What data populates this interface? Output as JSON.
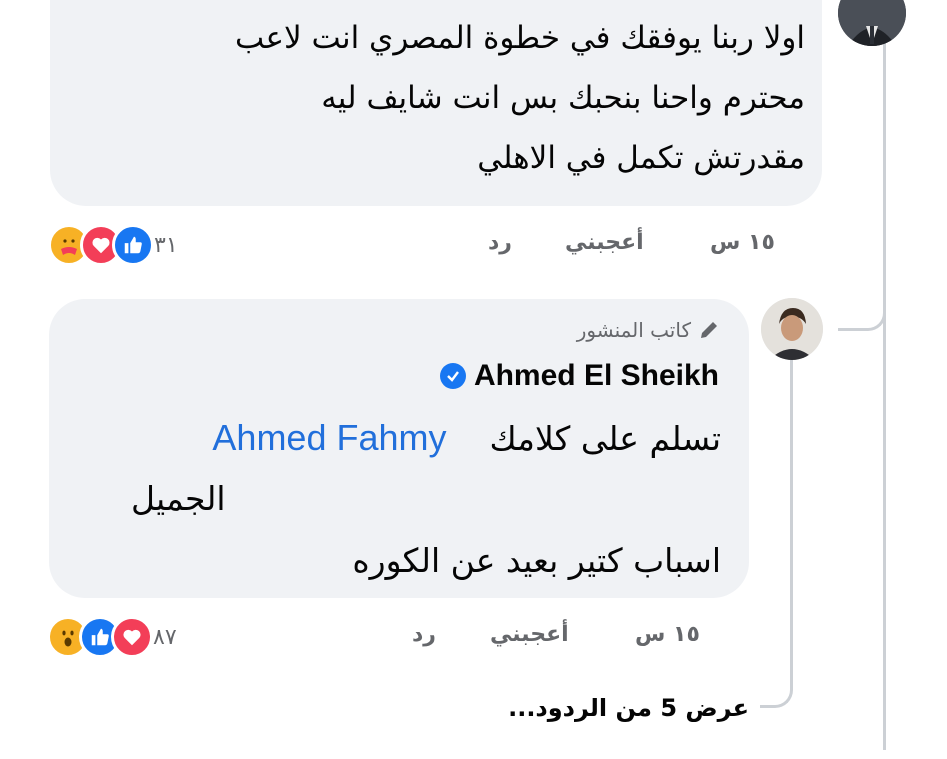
{
  "colors": {
    "bubble": "#f0f2f5",
    "thread_line": "#ccd0d5",
    "meta_text": "#65676b",
    "mention": "#216fdb",
    "like": "#1877f2",
    "love": "#f33e58",
    "care_wow": "#f7b125"
  },
  "comment1": {
    "lines": [
      "اولا ربنا يوفقك في خطوة المصري انت لاعب",
      "محترم واحنا بنحبك بس انت شايف ليه",
      "مقدرتش تكمل في الاهلي"
    ],
    "time": "١٥ س",
    "like_label": "أعجبني",
    "reply_label": "رد",
    "reaction_count": "٣١",
    "reactions": [
      "like-icon",
      "love-icon",
      "care-icon"
    ]
  },
  "comment2": {
    "author_badge_label": "كاتب المنشور",
    "author_name": "Ahmed El Sheikh",
    "mention": "Ahmed Fahmy",
    "line1": "تسلم على كلامك",
    "line2": "الجميل",
    "line3": "اسباب كتير بعيد عن الكوره",
    "time": "١٥ س",
    "like_label": "أعجبني",
    "reply_label": "رد",
    "reaction_count": "٨٧",
    "reactions": [
      "love-icon",
      "like-icon",
      "wow-icon"
    ]
  },
  "view_replies": "عرض 5 من الردود..."
}
